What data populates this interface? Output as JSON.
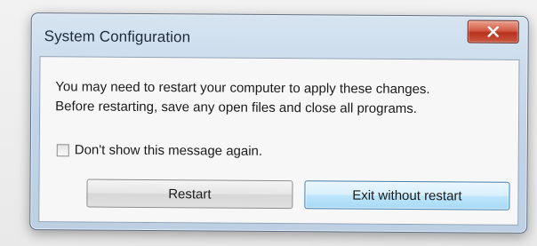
{
  "dialog": {
    "title": "System Configuration",
    "message_line1": "You may need to restart your computer to apply these changes.",
    "message_line2": "Before restarting, save any open files and close all programs.",
    "checkbox_label": "Don't show this message again.",
    "checkbox_checked": false,
    "restart_label": "Restart",
    "exit_label": "Exit without restart",
    "close_icon": "close-x-icon",
    "colors": {
      "close_button": "#c9473a",
      "frame": "#c3d5e8",
      "default_button_border": "#3c7fb1"
    }
  }
}
